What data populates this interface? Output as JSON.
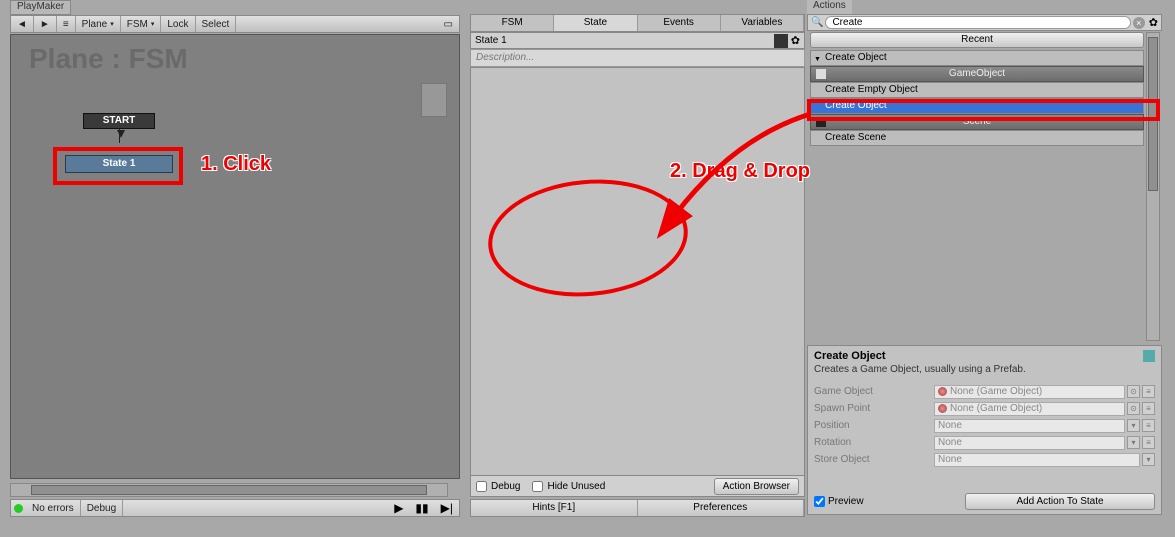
{
  "left": {
    "tab": "PlayMaker",
    "toolbar": {
      "plane": "Plane",
      "fsm": "FSM",
      "lock": "Lock",
      "select": "Select"
    },
    "graph_title": "Plane : FSM",
    "start": "START",
    "state1": "State 1",
    "status": {
      "no_errors": "No errors",
      "debug": "Debug"
    }
  },
  "anno": {
    "click": "1. Click",
    "drag": "2. Drag & Drop"
  },
  "mid": {
    "tabs": {
      "fsm": "FSM",
      "state": "State",
      "events": "Events",
      "vars": "Variables"
    },
    "state_name": "State 1",
    "desc_placeholder": "Description...",
    "debug": "Debug",
    "hide": "Hide Unused",
    "browser": "Action Browser",
    "hints": "Hints [F1]",
    "prefs": "Preferences"
  },
  "right": {
    "tab": "Actions",
    "search": "Create",
    "recent": "Recent",
    "cat1": "Create Object",
    "header1": "GameObject",
    "item1": "Create Empty Object",
    "item2": "Create Object",
    "header2": "Scene",
    "item3": "Create Scene",
    "detail": {
      "title": "Create Object",
      "desc": "Creates a Game Object, usually using a Prefab.",
      "props": {
        "game_object": "Game Object",
        "go_val": "None (Game Object)",
        "spawn": "Spawn Point",
        "sp_val": "None (Game Object)",
        "position": "Position",
        "pos_val": "None",
        "rotation": "Rotation",
        "rot_val": "None",
        "store": "Store Object",
        "store_val": "None"
      },
      "preview": "Preview",
      "add": "Add Action To State"
    }
  }
}
